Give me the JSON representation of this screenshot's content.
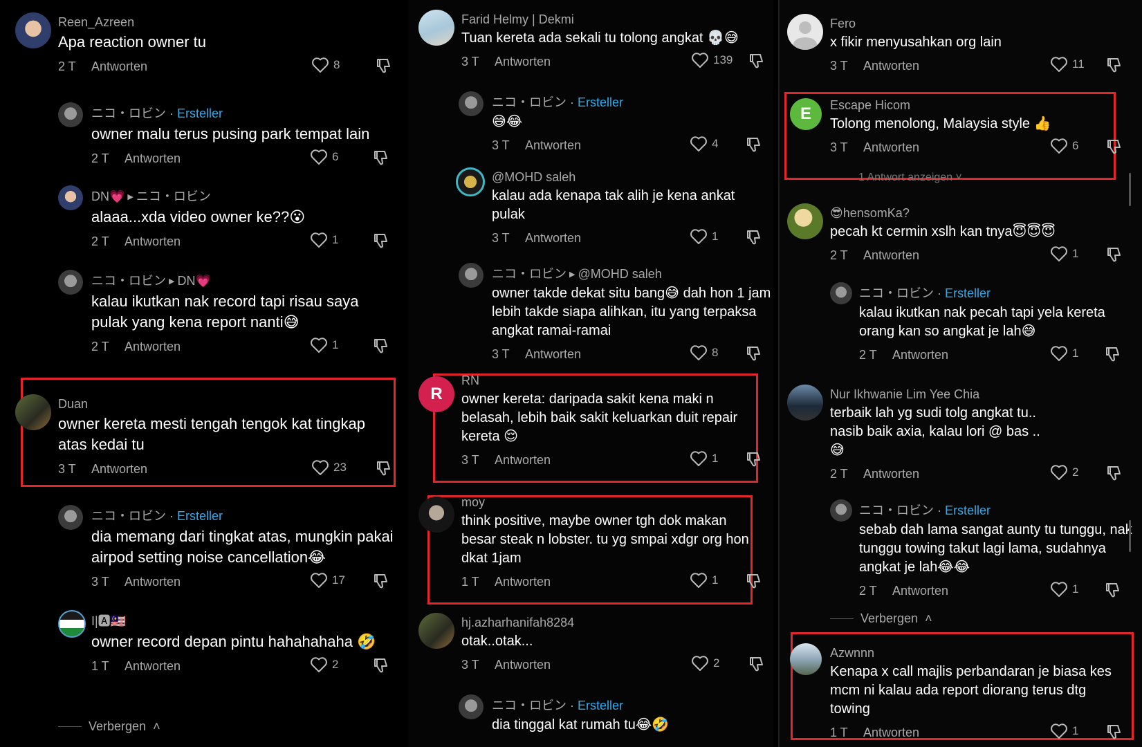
{
  "labels": {
    "reply": "Antworten",
    "creator": "Ersteller",
    "hide": "Verbergen",
    "show_replies": "1 Antwort anzeigen"
  },
  "col1": [
    {
      "user": "Reen_Azreen",
      "text": "Apa reaction owner tu",
      "time": "2 T",
      "likes": "8"
    },
    {
      "user": "ニコ・ロビン",
      "text": "owner malu terus pusing park tempat lain",
      "time": "2 T",
      "likes": "6"
    },
    {
      "user": "DN💗",
      "reply_to": "ニコ・ロビン",
      "text": "alaaa...xda video owner ke??😮",
      "time": "2 T",
      "likes": "1"
    },
    {
      "user": "ニコ・ロビン",
      "reply_to": "DN💗",
      "text": "kalau ikutkan nak record tapi risau saya pulak yang kena report nanti😅",
      "time": "2 T",
      "likes": "1"
    },
    {
      "user": "Duan",
      "text": "owner kereta mesti tengah tengok kat tingkap atas kedai tu",
      "time": "3 T",
      "likes": "23"
    },
    {
      "user": "ニコ・ロビン",
      "text": "dia memang dari tingkat atas, mungkin pakai airpod setting noise cancellation😂",
      "time": "3 T",
      "likes": "17"
    },
    {
      "user": "I|🅰🇲🇾",
      "text": "owner record depan pintu hahahahaha 🤣",
      "time": "1 T",
      "likes": "2"
    }
  ],
  "col2": [
    {
      "user": "Farid Helmy | Dekmi",
      "text": "Tuan kereta ada sekali tu tolong angkat 💀😅",
      "time": "3 T",
      "likes": "139"
    },
    {
      "user": "ニコ・ロビン",
      "text": "😅😂",
      "time": "3 T",
      "likes": "4"
    },
    {
      "user": "@MOHD saleh",
      "text": "kalau ada kenapa tak alih je kena ankat pulak",
      "time": "3 T",
      "likes": "1"
    },
    {
      "user": "ニコ・ロビン",
      "reply_to": "@MOHD saleh",
      "text": "owner takde dekat situ bang😅 dah hon 1 jam lebih takde siapa alihkan, itu yang terpaksa angkat ramai-ramai",
      "time": "3 T",
      "likes": "8"
    },
    {
      "user": "RN",
      "text": "owner kereta: daripada sakit kena maki n belasah, lebih baik sakit keluarkan duit repair kereta 😌",
      "time": "3 T",
      "likes": "1"
    },
    {
      "user": "moy",
      "text": "think positive, maybe owner tgh dok makan besar steak n lobster. tu yg smpai xdgr org hon dkat 1jam",
      "time": "1 T",
      "likes": "1"
    },
    {
      "user": "hj.azharhanifah8284",
      "text": "otak..otak...",
      "time": "3 T",
      "likes": "2"
    },
    {
      "user": "ニコ・ロビン",
      "text": "dia tinggal kat rumah tu😂🤣"
    }
  ],
  "col3": [
    {
      "user": "Fero",
      "text": "x fikir menyusahkan org lain",
      "time": "3 T",
      "likes": "11"
    },
    {
      "user": "Escape Hicom",
      "avatar_letter": "E",
      "text": "Tolong menolong, Malaysia style 👍",
      "time": "3 T",
      "likes": "6"
    },
    {
      "user": "😎hensomKa?",
      "text": "pecah kt cermin xslh kan tnya😇😇😇",
      "time": "2 T",
      "likes": "1"
    },
    {
      "user": "ニコ・ロビン",
      "text": "kalau ikutkan nak pecah tapi yela kereta orang kan so angkat je lah😅",
      "time": "2 T",
      "likes": "1"
    },
    {
      "user": "Nur Ikhwanie Lim Yee Chia",
      "text": "terbaik lah yg sudi tolg angkat tu.. nasib baik axia, kalau lori @ bas .. 😅",
      "time": "2 T",
      "likes": "2"
    },
    {
      "user": "ニコ・ロビン",
      "text": "sebab dah lama sangat aunty tu tunggu, nak tunggu towing takut lagi lama, sudahnya angkat je lah😂😂",
      "time": "2 T",
      "likes": "1"
    },
    {
      "user": "Azwnnn",
      "text": "Kenapa x call majlis perbandaran je biasa kes mcm ni kalau ada report diorang terus dtg towing",
      "time": "1 T",
      "likes": "1"
    }
  ],
  "col2_avatar_letter": "R"
}
